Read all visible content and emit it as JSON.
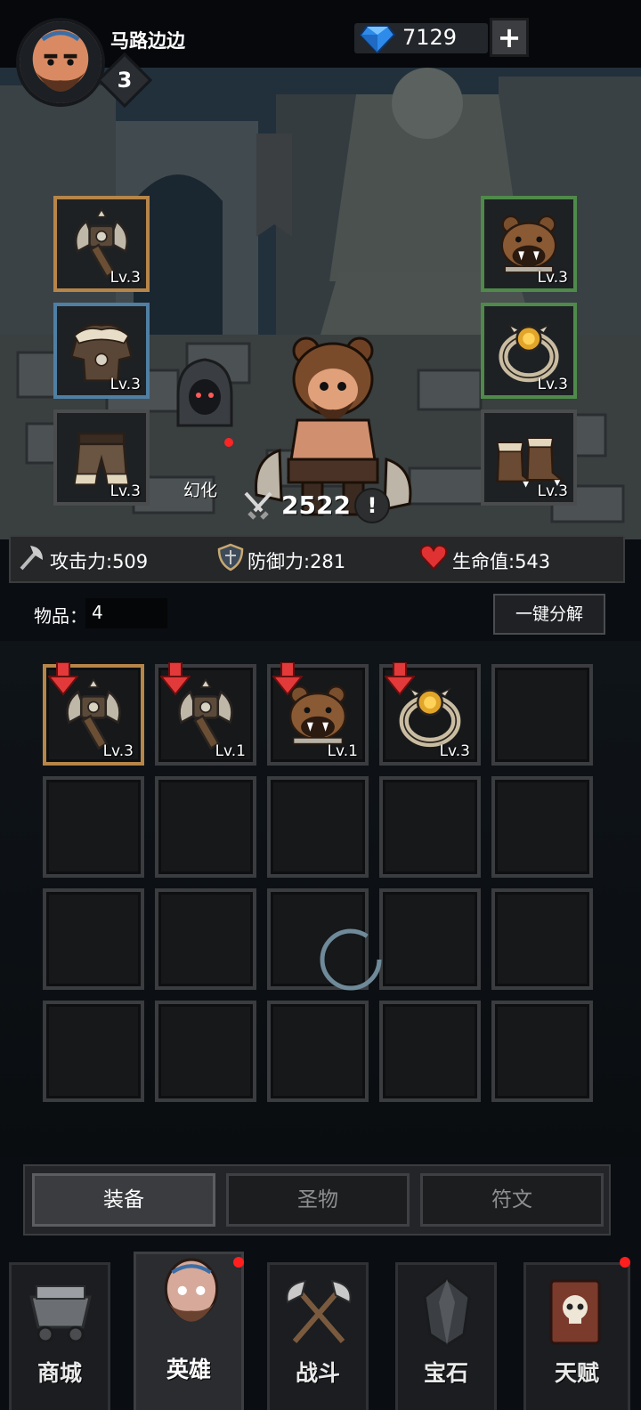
{
  "player": {
    "name": "马路边边",
    "level": "3",
    "avatar_icon": "bearded-warrior-portrait"
  },
  "currency": {
    "gems": "7129",
    "gem_icon": "blue-diamond-icon",
    "add_label": "+"
  },
  "equipment": {
    "left_slots": [
      {
        "icon": "battle-axe-icon",
        "level": "Lv.3",
        "rarity": "gold"
      },
      {
        "icon": "fur-armor-icon",
        "level": "Lv.3",
        "rarity": "blue"
      },
      {
        "icon": "fur-pants-icon",
        "level": "Lv.3",
        "rarity": "gray"
      }
    ],
    "right_slots": [
      {
        "icon": "bear-helmet-icon",
        "level": "Lv.3",
        "rarity": "green"
      },
      {
        "icon": "gold-ring-icon",
        "level": "Lv.3",
        "rarity": "green"
      },
      {
        "icon": "fur-boots-icon",
        "level": "Lv.3",
        "rarity": "gray"
      }
    ],
    "transform_label": "幻化",
    "combat_power": "2522",
    "info_label": "!"
  },
  "stats": {
    "attack": "攻击力:509",
    "defense": "防御力:281",
    "health": "生命值:543"
  },
  "inventory": {
    "items_label": "物品：",
    "items_count": "4",
    "decompose_label": "一键分解",
    "slots": [
      {
        "icon": "battle-axe-icon",
        "level": "Lv.3",
        "upgrade_arrow": true,
        "rarity": "gold"
      },
      {
        "icon": "battle-axe-icon",
        "level": "Lv.1",
        "upgrade_arrow": true,
        "rarity": "none"
      },
      {
        "icon": "bear-helmet-icon",
        "level": "Lv.1",
        "upgrade_arrow": true,
        "rarity": "none"
      },
      {
        "icon": "gold-ring-icon",
        "level": "Lv.3",
        "upgrade_arrow": true,
        "rarity": "none"
      }
    ],
    "total_slots": 20
  },
  "tabs": [
    {
      "label": "装备",
      "active": true
    },
    {
      "label": "圣物",
      "active": false
    },
    {
      "label": "符文",
      "active": false
    }
  ],
  "nav": [
    {
      "label": "商城",
      "icon": "minecart-icon",
      "active": false,
      "badge": false
    },
    {
      "label": "英雄",
      "icon": "hero-portrait-icon",
      "active": true,
      "badge": true
    },
    {
      "label": "战斗",
      "icon": "crossed-axes-icon",
      "active": false,
      "badge": false
    },
    {
      "label": "宝石",
      "icon": "dark-gem-icon",
      "active": false,
      "badge": false
    },
    {
      "label": "天赋",
      "icon": "skull-book-icon",
      "active": false,
      "badge": true
    }
  ],
  "colors": {
    "gold_border": "#b68549",
    "blue_border": "#4f7fa3",
    "green_border": "#4f8a4a",
    "badge_red": "#ff1f1f"
  }
}
